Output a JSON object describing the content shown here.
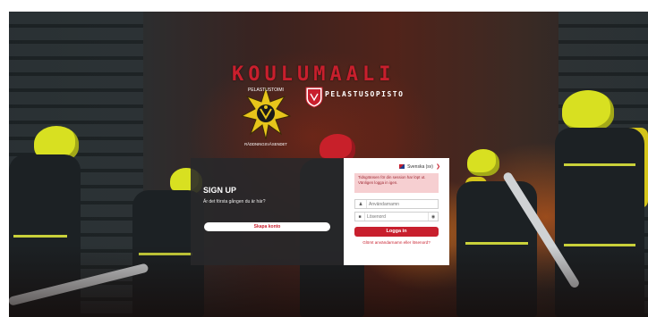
{
  "brand": {
    "title": "KOULUMAALI",
    "org_name": "PELASTUSOPISTO",
    "crest_top_text": "PELASTUSTOIMI",
    "crest_bottom_text": "RÄDDNINGSVÄSENDET"
  },
  "signup": {
    "title": "SIGN UP",
    "question": "Är det första gången du är här?",
    "button_label": "Skapa konto"
  },
  "login": {
    "language": "Svenska (sv)",
    "alert_text": "Tidsgränsen för din session har löpt ut. Vänligen logga in igen.",
    "username_placeholder": "Användarnamn",
    "password_placeholder": "Lösenord",
    "submit_label": "Logga in",
    "forgot_link": "Glömt användarnamn eller lösenord?"
  },
  "icons": {
    "language_flag": "flag-icon",
    "language_chevron": "chevron-down-icon",
    "username": "user-icon",
    "password": "lock-icon",
    "reveal": "eye-icon"
  },
  "colors": {
    "brand_red": "#c81f2d",
    "alert_bg": "#f6cfd1",
    "panel_dark": "#28282a"
  }
}
